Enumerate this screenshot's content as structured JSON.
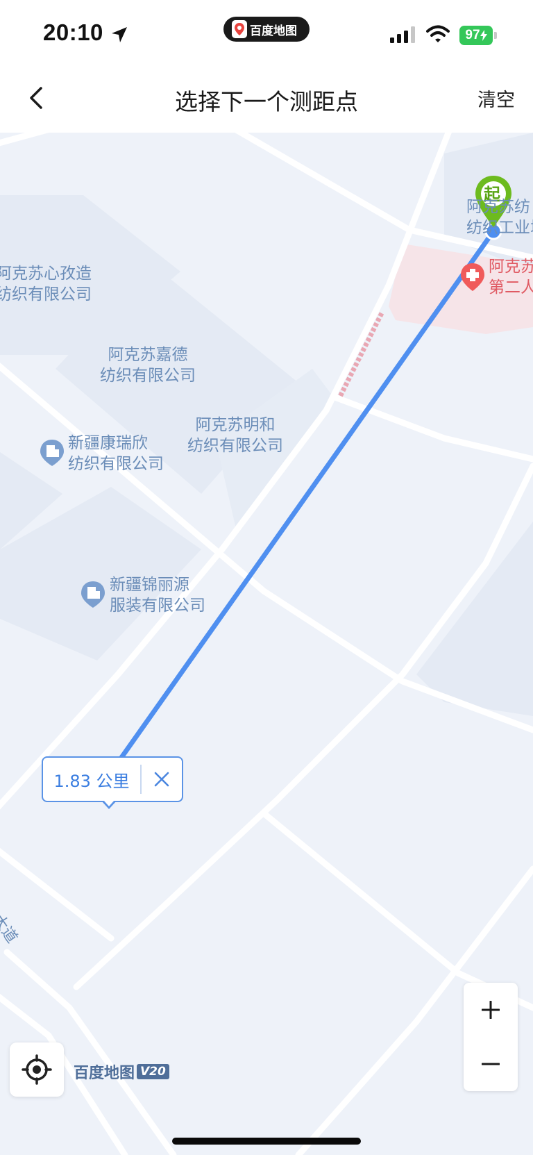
{
  "status_bar": {
    "time": "20:10",
    "app_name": "百度地图",
    "battery": "97"
  },
  "nav": {
    "title": "选择下一个测距点",
    "clear_label": "清空"
  },
  "map": {
    "start_marker_label": "起",
    "distance": "1.83 公里",
    "labels": {
      "poi_top_right": "阿克苏纺\n纺织工业城",
      "hospital": "阿克苏\n第二人",
      "xinzhizao": "阿克苏心孜造\n纺织有限公司",
      "jiade": "阿克苏嘉德\n纺织有限公司",
      "minghe": "阿克苏明和\n纺织有限公司",
      "kangruixin": "新疆康瑞欣\n纺织有限公司",
      "jinliyuan": "新疆锦丽源\n服装有限公司",
      "road": "大道"
    },
    "brand": "百度地图",
    "brand_version": "V20"
  },
  "colors": {
    "route_line": "#4f8ff0",
    "start_marker": "#6dbb1e",
    "end_marker": "#f23b3b",
    "hospital": "#f05a5a"
  }
}
